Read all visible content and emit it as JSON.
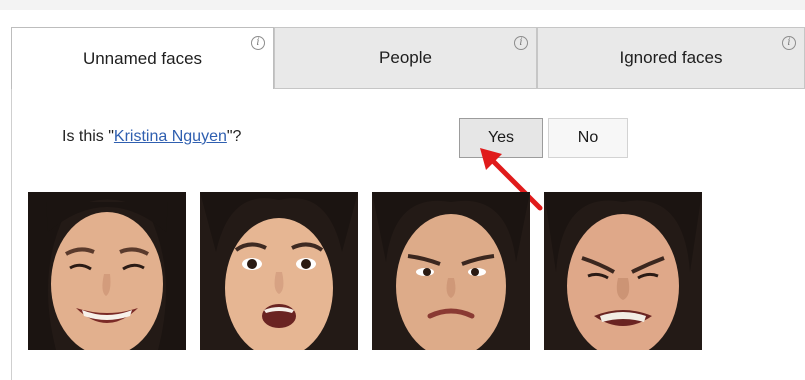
{
  "tabs": [
    {
      "label": "Unnamed faces",
      "active": true
    },
    {
      "label": "People",
      "active": false
    },
    {
      "label": "Ignored faces",
      "active": false
    }
  ],
  "prompt": {
    "prefix": "Is this \"",
    "name": "Kristina Nguyen",
    "suffix": "\"?"
  },
  "buttons": {
    "yes": "Yes",
    "no": "No"
  },
  "faces": [
    "smiling",
    "surprised",
    "frowning",
    "disgusted"
  ],
  "colors": {
    "link": "#2f5fb0",
    "arrow": "#e01b1b",
    "tab_inactive": "#e9e9e9"
  }
}
